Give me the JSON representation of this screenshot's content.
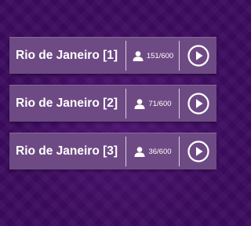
{
  "rooms": [
    {
      "name": "Rio de Janeiro [1]",
      "players": "151/600"
    },
    {
      "name": "Rio de Janeiro [2]",
      "players": "71/600"
    },
    {
      "name": "Rio de Janeiro [3]",
      "players": "36/600"
    }
  ],
  "icons": {
    "players": "user-icon",
    "join": "play-icon"
  },
  "colors": {
    "background": "#3b0a5e",
    "card": "#6e4a84",
    "text": "#ffffff"
  }
}
